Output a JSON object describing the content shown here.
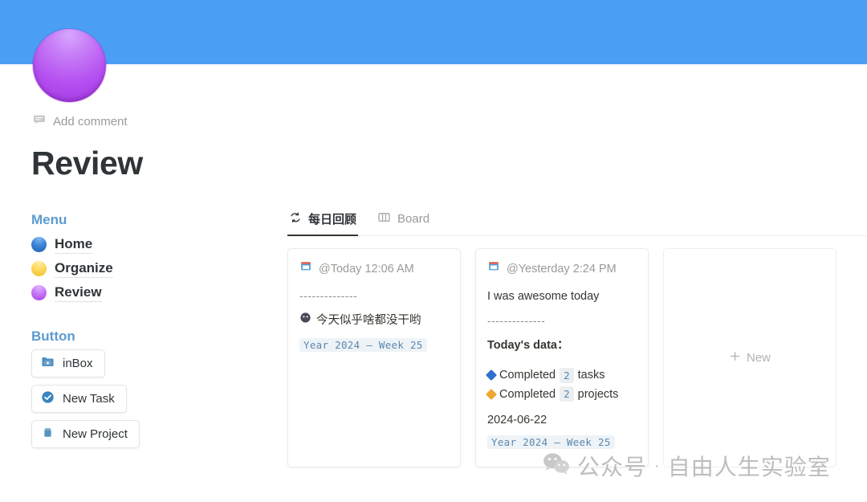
{
  "cover": {
    "color": "#4a9ff5"
  },
  "avatar": {
    "icon": "purple-circle-emoji",
    "color": "#b44ef0"
  },
  "comment": {
    "icon": "comment-bubble-icon",
    "label": "Add comment"
  },
  "page": {
    "title": "Review"
  },
  "sidebar": {
    "menu_heading": "Menu",
    "menu_items": [
      {
        "label": "Home",
        "icon": "blue-circle-icon",
        "color": "#3d86d8"
      },
      {
        "label": "Organize",
        "icon": "yellow-circle-icon",
        "color": "#ffd95c"
      },
      {
        "label": "Review",
        "icon": "purple-circle-icon",
        "color": "#c77cf7"
      }
    ],
    "button_heading": "Button",
    "buttons": [
      {
        "label": "inBox",
        "icon": "folder-plus-icon"
      },
      {
        "label": "New Task",
        "icon": "check-circle-icon"
      },
      {
        "label": "New Project",
        "icon": "project-icon"
      }
    ]
  },
  "main": {
    "tabs": [
      {
        "label": "每日回顾",
        "icon": "sync-arrows-icon",
        "active": true
      },
      {
        "label": "Board",
        "icon": "board-columns-icon",
        "active": false
      }
    ],
    "cards": [
      {
        "head_icon": "calendar-icon",
        "head": "@Today 12:06 AM",
        "divider": "--------------",
        "emoji": "dark-face-emoji",
        "emoji_text": "今天似乎啥都没干哟",
        "code": "Year 2024 – Week 25"
      },
      {
        "head_icon": "calendar-icon",
        "head": "@Yesterday 2:24 PM",
        "note": "I was awesome today",
        "divider": "--------------",
        "subtitle": "Today's data：",
        "stats": [
          {
            "bullet": "blue-diamond-icon",
            "prefix": "Completed",
            "count": "2",
            "suffix": "tasks"
          },
          {
            "bullet": "orange-diamond-icon",
            "prefix": "Completed",
            "count": "2",
            "suffix": "projects"
          }
        ],
        "date": "2024-06-22",
        "code": "Year 2024 – Week 25"
      }
    ],
    "new_card": {
      "icon": "plus-icon",
      "label": "New"
    }
  },
  "watermark": {
    "icon": "wechat-icon",
    "text_left": "公众号",
    "separator": "·",
    "text_right": "自由人生实验室"
  }
}
